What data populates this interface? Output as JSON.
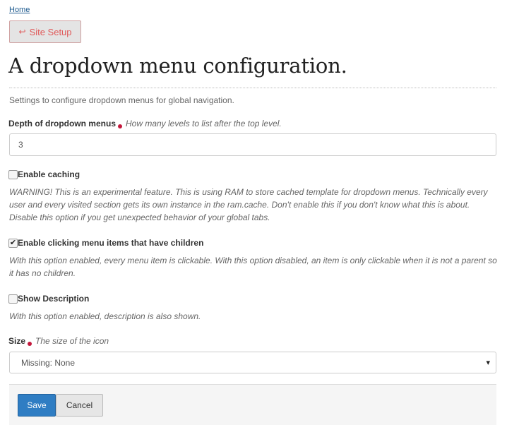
{
  "breadcrumb": {
    "home": "Home"
  },
  "back_button": {
    "label": "Site Setup",
    "icon": "return-arrow-icon"
  },
  "page": {
    "title": "A dropdown menu configuration.",
    "description": "Settings to configure dropdown menus for global navigation."
  },
  "fields": {
    "depth": {
      "label": "Depth of dropdown menus",
      "help": "How many levels to list after the top level.",
      "value": "3"
    },
    "enable_caching": {
      "label": "Enable caching",
      "checked": false,
      "help": "WARNING! This is an experimental feature. This is using RAM to store cached template for dropdown menus. Technically every user and every visited section gets its own instance in the ram.cache. Don't enable this if you don't know what this is about. Disable this option if you get unexpected behavior of your global tabs."
    },
    "enable_clicking": {
      "label": "Enable clicking menu items that have children",
      "checked": true,
      "check_glyph": "✔",
      "help": "With this option enabled, every menu item is clickable. With this option disabled, an item is only clickable when it is not a parent so it has no children."
    },
    "show_description": {
      "label": "Show Description",
      "checked": false,
      "help": "With this option enabled, description is also shown."
    },
    "size": {
      "label": "Size",
      "help": "The size of the icon",
      "selected": "Missing: None",
      "caret": "▾"
    }
  },
  "actions": {
    "save_label": "Save",
    "cancel_label": "Cancel"
  },
  "colors": {
    "primary": "#2f7dc3",
    "required": "#c4183c",
    "back_button_text": "#e05a5a"
  }
}
